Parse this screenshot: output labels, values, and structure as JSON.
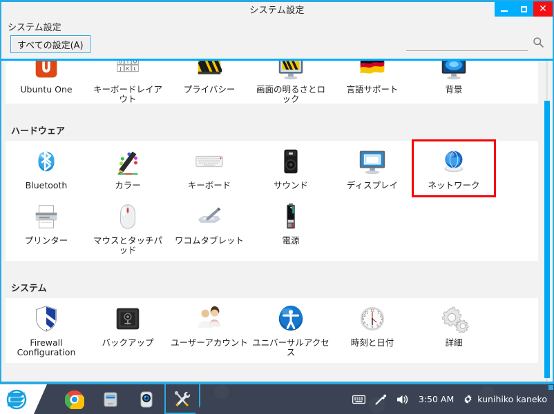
{
  "window": {
    "title": "システム設定",
    "controls": {
      "minimize": "minimize-button",
      "maximize": "maximize-button",
      "close": "close-button"
    }
  },
  "toolbar": {
    "app_label": "システム設定",
    "all_settings_button": "すべての設定(A)",
    "search_placeholder": "",
    "search_value": "",
    "search_icon": "search-icon"
  },
  "sections": [
    {
      "name": "personal-clipped",
      "header": "",
      "rows": [
        [
          {
            "label": "Ubuntu One",
            "icon": "ubuntu-one-icon",
            "selected": false
          },
          {
            "label": "キーボードレイアウト",
            "icon": "keyboard-layout-icon",
            "selected": false
          },
          {
            "label": "プライバシー",
            "icon": "privacy-icon",
            "selected": false
          },
          {
            "label": "画面の明るさとロック",
            "icon": "brightness-lock-icon",
            "selected": false
          },
          {
            "label": "言語サポート",
            "icon": "language-support-icon",
            "selected": false
          },
          {
            "label": "背景",
            "icon": "background-icon",
            "selected": false
          }
        ]
      ]
    },
    {
      "name": "hardware",
      "header": "ハードウェア",
      "rows": [
        [
          {
            "label": "Bluetooth",
            "icon": "bluetooth-icon",
            "selected": false
          },
          {
            "label": "カラー",
            "icon": "color-icon",
            "selected": false
          },
          {
            "label": "キーボード",
            "icon": "keyboard-icon",
            "selected": false
          },
          {
            "label": "サウンド",
            "icon": "sound-icon",
            "selected": false
          },
          {
            "label": "ディスプレイ",
            "icon": "display-icon",
            "selected": false
          },
          {
            "label": "ネットワーク",
            "icon": "network-icon",
            "selected": true
          }
        ],
        [
          {
            "label": "プリンター",
            "icon": "printer-icon",
            "selected": false
          },
          {
            "label": "マウスとタッチパッド",
            "icon": "mouse-touchpad-icon",
            "selected": false
          },
          {
            "label": "ワコムタブレット",
            "icon": "wacom-tablet-icon",
            "selected": false
          },
          {
            "label": "電源",
            "icon": "power-icon",
            "selected": false
          }
        ]
      ]
    },
    {
      "name": "system",
      "header": "システム",
      "rows": [
        [
          {
            "label": "Firewall Configuration",
            "icon": "firewall-icon",
            "selected": false
          },
          {
            "label": "バックアップ",
            "icon": "backup-icon",
            "selected": false
          },
          {
            "label": "ユーザーアカウント",
            "icon": "user-accounts-icon",
            "selected": false
          },
          {
            "label": "ユニバーサルアクセス",
            "icon": "universal-access-icon",
            "selected": false
          },
          {
            "label": "時刻と日付",
            "icon": "time-date-icon",
            "selected": false
          },
          {
            "label": "詳細",
            "icon": "details-icon",
            "selected": false
          }
        ]
      ]
    }
  ],
  "taskbar": {
    "start_icon": "zorin-start-icon",
    "items": [
      {
        "icon": "chrome-icon",
        "active": false
      },
      {
        "icon": "file-manager-icon",
        "active": false
      },
      {
        "icon": "webcam-app-icon",
        "active": false
      },
      {
        "icon": "system-tools-icon",
        "active": true
      }
    ],
    "tray": {
      "keyboard_icon": "keyboard-tray-icon",
      "pen_icon": "pen-tray-icon",
      "volume_icon": "volume-tray-icon",
      "clock": "3:50 AM",
      "gear_icon": "gear-tray-icon",
      "username": "kunihiko kaneko"
    }
  },
  "colors": {
    "accent": "#00aeff",
    "close": "#f40f12",
    "selection": "#f60000",
    "taskbar": "#3a4253"
  }
}
